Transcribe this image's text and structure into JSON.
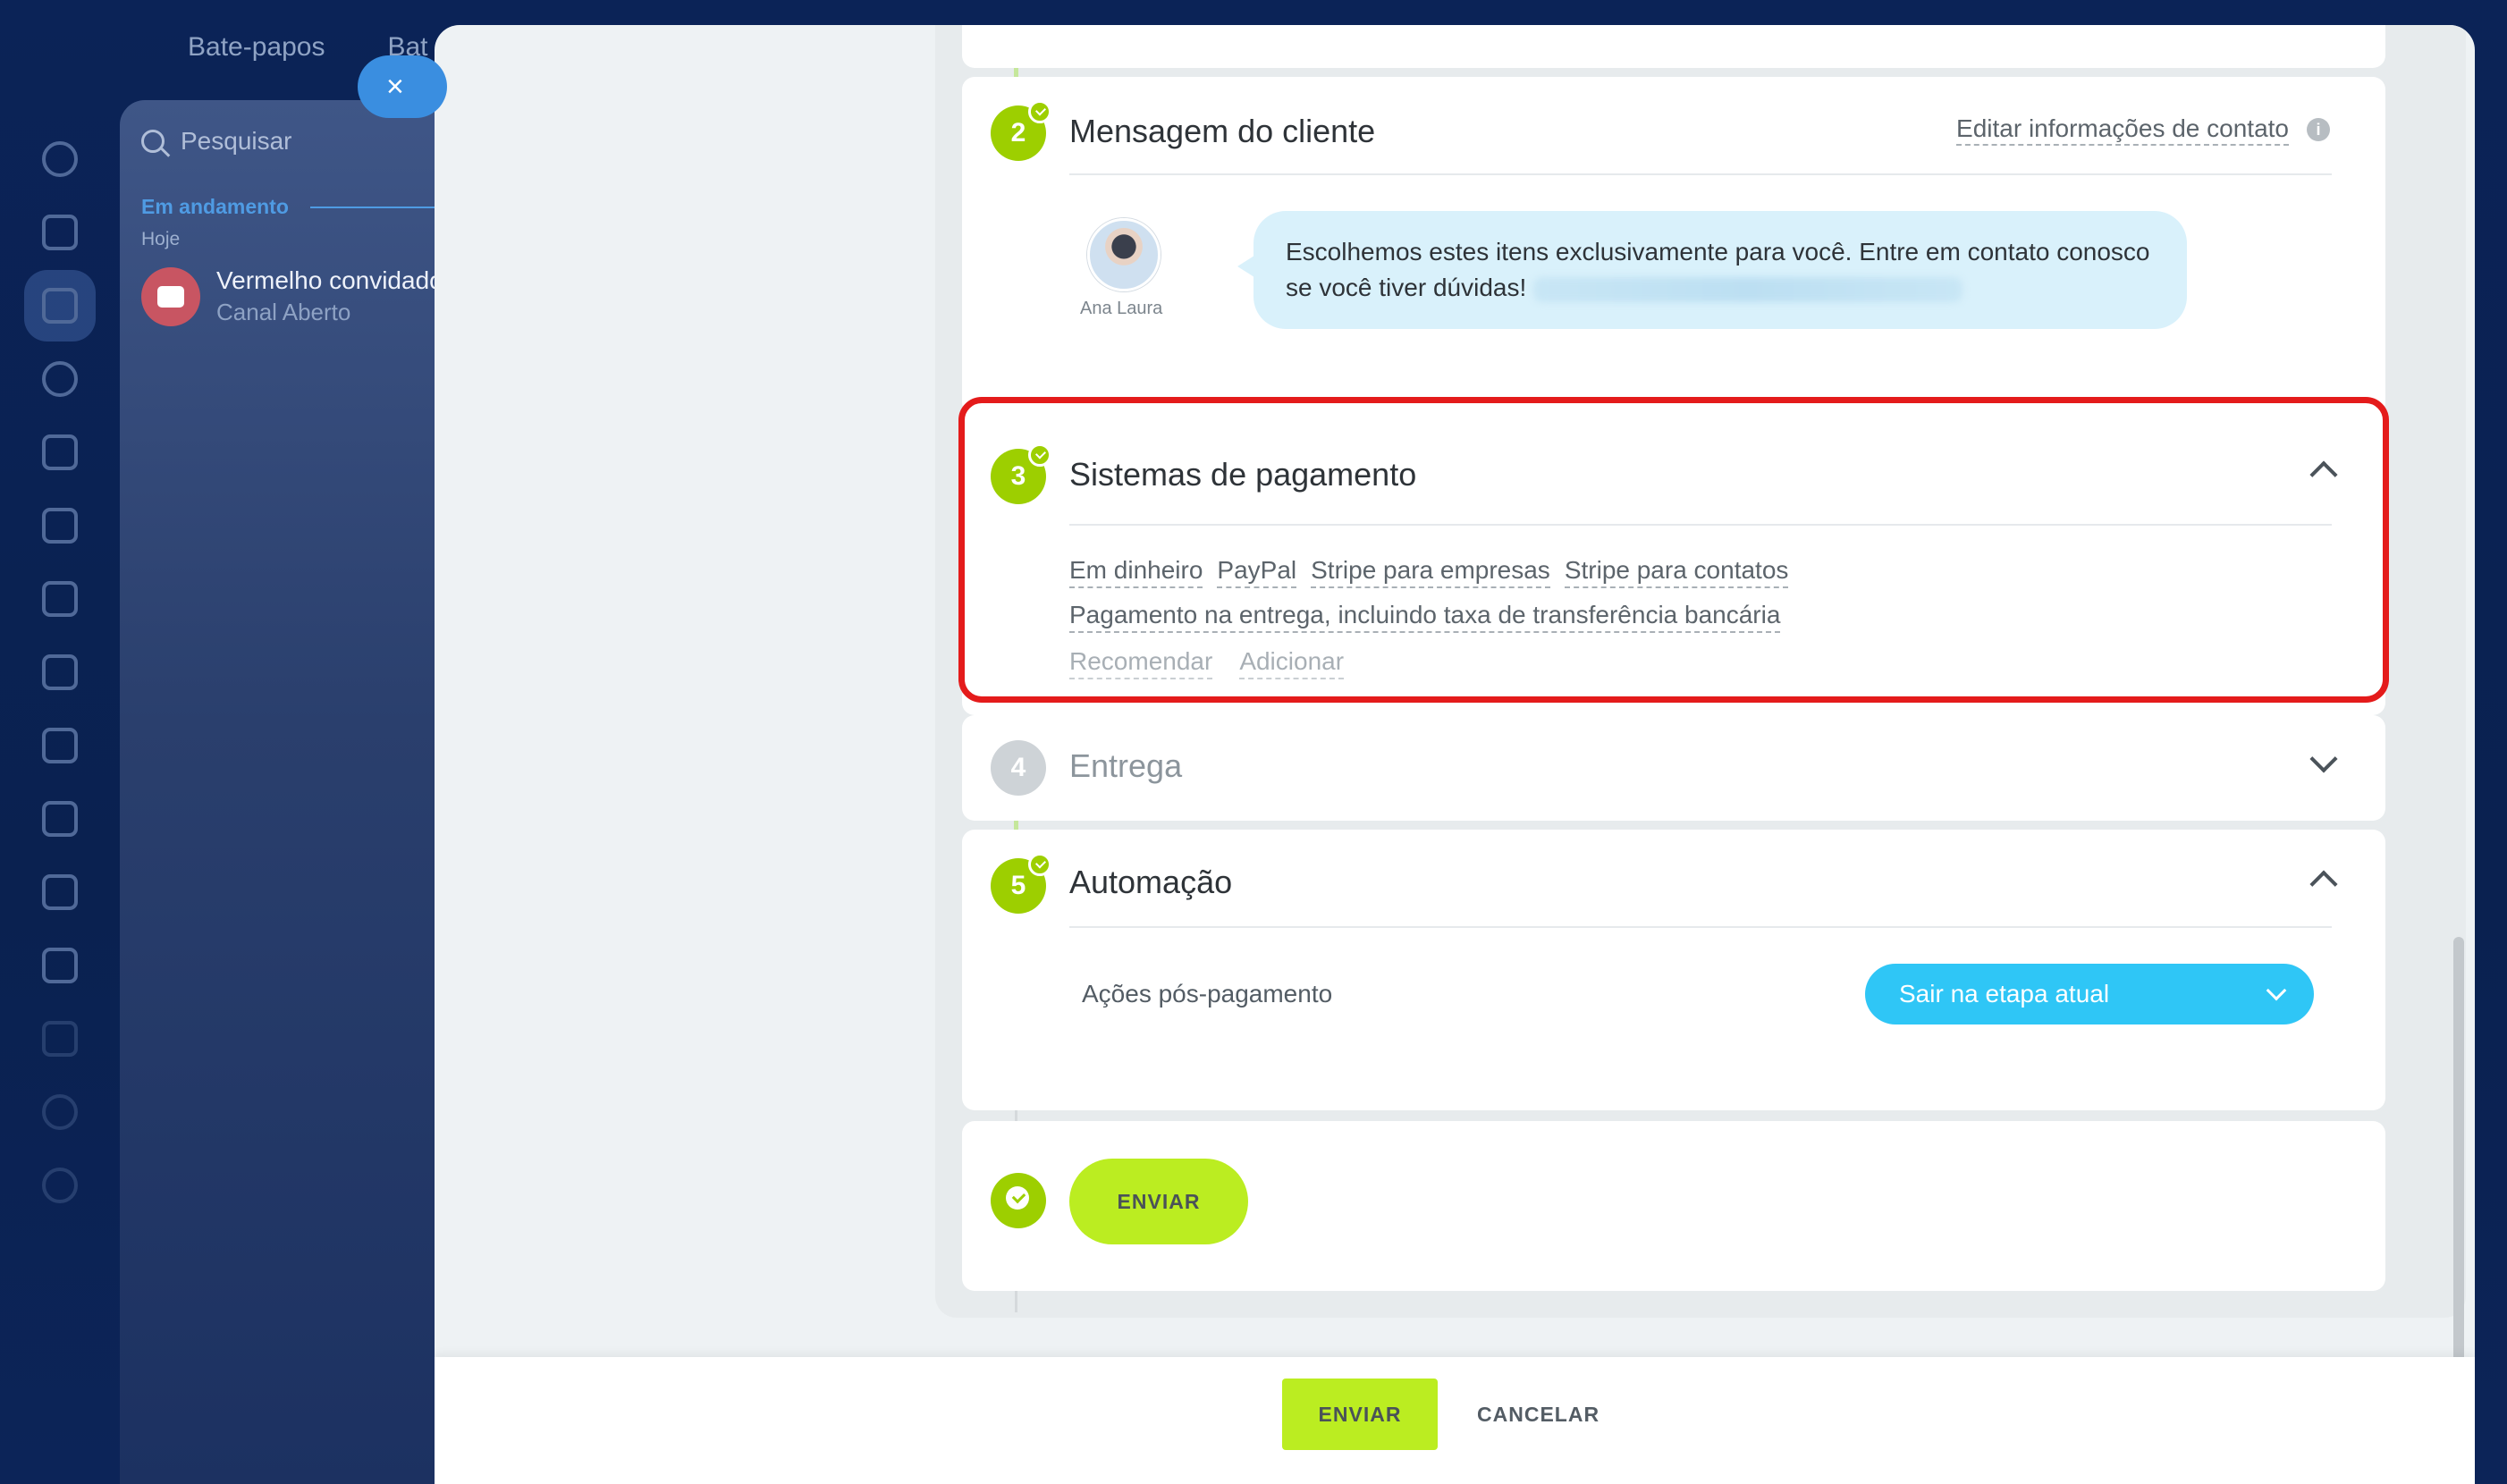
{
  "background": {
    "tabs": [
      "Bate-papos",
      "Bat"
    ],
    "search_placeholder": "Pesquisar",
    "section_label": "Em andamento",
    "today_label": "Hoje",
    "chat": {
      "title": "Vermelho convidado",
      "subtitle": "Canal Aberto"
    },
    "sidebar_icons": [
      "flow-icon",
      "checkbox-icon",
      "filter-icon",
      "target-icon",
      "cart-icon",
      "contact-card-icon",
      "bar-chart-icon",
      "robot-icon",
      "box-icon",
      "store-icon",
      "pen-icon",
      "document-icon",
      "calendar-icon",
      "hexagon-icon",
      "settings-icon"
    ]
  },
  "close_button": {
    "label": "×"
  },
  "step2": {
    "number": "2",
    "title": "Mensagem do cliente",
    "edit_contact_link": "Editar informações de contato",
    "info_icon": "i",
    "sender_name": "Ana Laura",
    "message": "Escolhemos estes itens exclusivamente para você. Entre em contato conosco se você tiver dúvidas!"
  },
  "step3": {
    "number": "3",
    "title": "Sistemas de pagamento",
    "payment_methods_row1": [
      "Em dinheiro",
      "PayPal",
      "Stripe para empresas",
      "Stripe para contatos"
    ],
    "payment_methods_row2": [
      "Pagamento na entrega, incluindo taxa de transferência bancária"
    ],
    "actions": [
      "Recomendar",
      "Adicionar"
    ]
  },
  "step4": {
    "number": "4",
    "title": "Entrega"
  },
  "step5": {
    "number": "5",
    "title": "Automação",
    "field_label": "Ações pós-pagamento",
    "select_value": "Sair na etapa atual"
  },
  "final_step": {
    "send_label": "ENVIAR"
  },
  "footer": {
    "send_label": "ENVIAR",
    "cancel_label": "CANCELAR"
  },
  "colors": {
    "accent_green": "#9dcf00",
    "button_green": "#bbed21",
    "select_blue": "#2fc6f6",
    "highlight_red": "#e41b1b"
  }
}
